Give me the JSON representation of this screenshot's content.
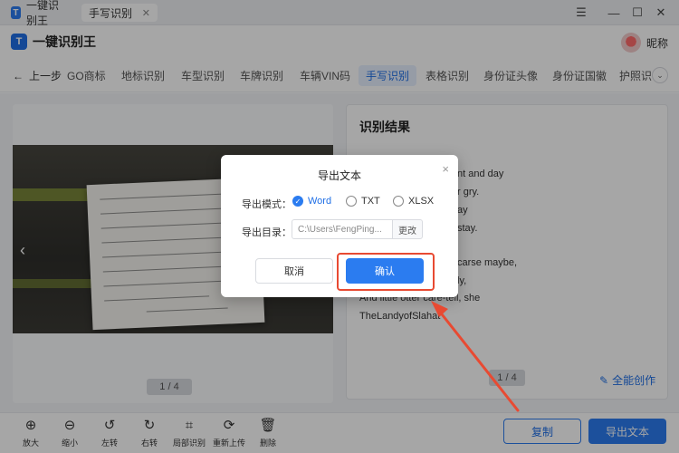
{
  "titlebar": {
    "app_tab": "一键识别王",
    "doc_tab": "手写识别",
    "close_glyph": "✕",
    "minimize_glyph": "—",
    "maximize_glyph": "☐",
    "window_close_glyph": "✕",
    "menu_glyph": "☰"
  },
  "header": {
    "app_name": "一键识别王",
    "user_name": "昵称"
  },
  "nav": {
    "back": "上一步",
    "items": [
      "GO商标",
      "地标识别",
      "车型识别",
      "车牌识别",
      "车辆VIN码",
      "手写识别",
      "表格识别",
      "身份证头像",
      "身份证国徽",
      "护照识"
    ],
    "active_index": 5
  },
  "preview": {
    "page_indicator": "1 / 4",
    "prev_glyph": "‹",
    "next_glyph": "›"
  },
  "result": {
    "title": "识别结果",
    "lines": [
      "nt and day",
      "r gry.",
      "ay",
      "stay.",
      "",
      "carse maybe,",
      "ly,",
      "And little otter care-tell, she",
      "TheLandyofSlahat"
    ],
    "page_indicator": "1 / 4",
    "ai_create": "全能创作"
  },
  "toolbar": {
    "tools": [
      {
        "label": "放大",
        "icon": "⊕"
      },
      {
        "label": "缩小",
        "icon": "⊖"
      },
      {
        "label": "左转",
        "icon": "↺"
      },
      {
        "label": "右转",
        "icon": "↻"
      },
      {
        "label": "局部识别",
        "icon": "⌗"
      },
      {
        "label": "重新上传",
        "icon": "⟳"
      },
      {
        "label": "删除",
        "icon": "🗑"
      }
    ],
    "copy": "复制",
    "export": "导出文本"
  },
  "dialog": {
    "title": "导出文本",
    "close_glyph": "×",
    "mode_label": "导出模式：",
    "modes": [
      "Word",
      "TXT",
      "XLSX"
    ],
    "selected_mode": "Word",
    "dir_label": "导出目录：",
    "dir_value": "C:\\Users\\FengPing...",
    "change": "更改",
    "cancel": "取消",
    "confirm": "确认"
  },
  "colors": {
    "accent": "#2b7cf0",
    "annotation": "#e84a32"
  }
}
